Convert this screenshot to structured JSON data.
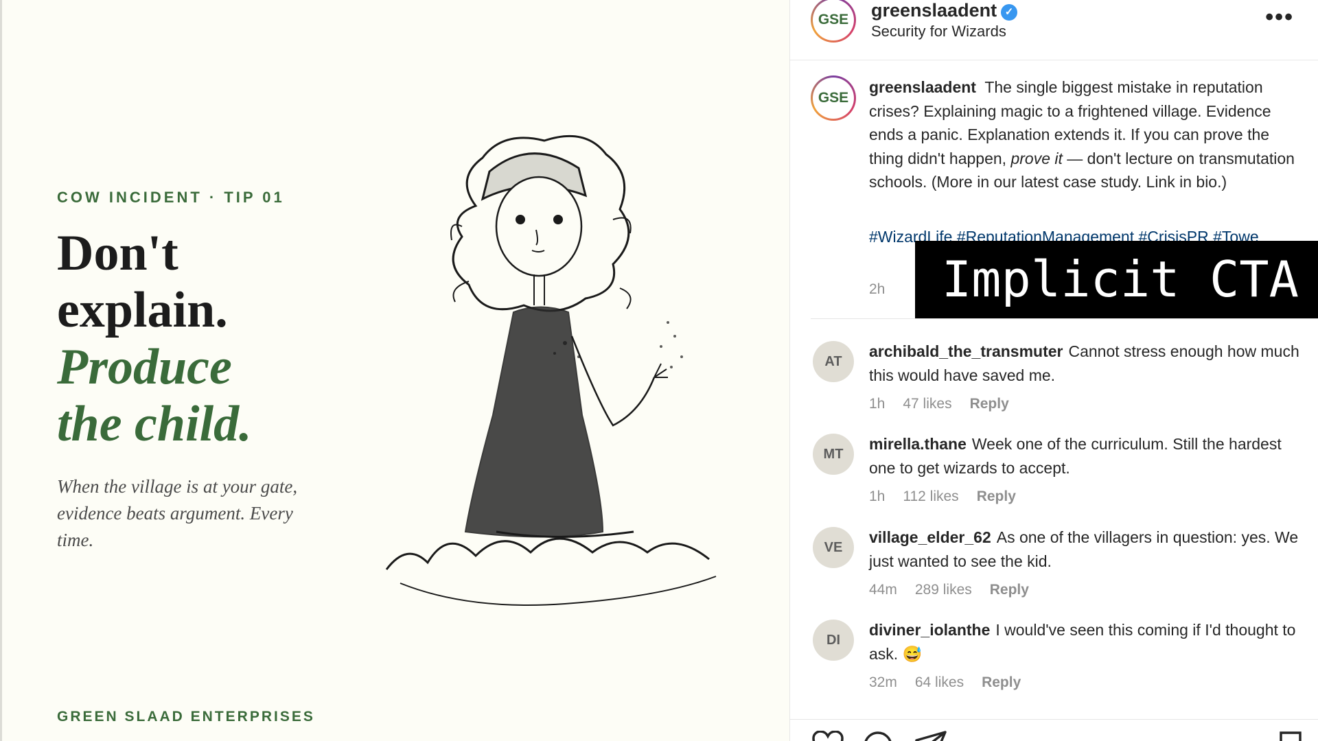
{
  "post": {
    "eyebrow": "COW INCIDENT · TIP 01",
    "headline_line1": "Don't",
    "headline_line2": "explain.",
    "headline_line3": "Produce",
    "headline_line4": "the child.",
    "subhead": "When the village is at your gate, evidence beats argument. Every time.",
    "brand": "GREEN SLAAD ENTERPRISES"
  },
  "header": {
    "avatar_text": "GSE",
    "username": "greenslaadent",
    "verified": "✓",
    "subtitle": "Security for Wizards",
    "more_icon": "more-icon"
  },
  "caption": {
    "avatar_text": "GSE",
    "username": "greenslaadent",
    "text_before": "The single biggest mistake in reputation crises? Explaining magic to a frightened village. Evidence ends a panic. Explanation extends it. If you can prove the thing didn't happen, ",
    "text_emph": "prove it",
    "text_after": " — don't lecture on transmutation schools. (More in our latest case study. Link in bio.)",
    "hashtags": "#WizardLife #ReputationManagement #CrisisPR #Towe",
    "time": "2h"
  },
  "overlay": {
    "label": "Implicit CTA"
  },
  "comments": [
    {
      "initials": "AT",
      "user": "archibald_the_transmuter",
      "text": "Cannot stress enough how much this would have saved me.",
      "time": "1h",
      "likes": "47 likes",
      "reply": "Reply"
    },
    {
      "initials": "MT",
      "user": "mirella.thane",
      "text": "Week one of the curriculum. Still the hardest one to get wizards to accept.",
      "time": "1h",
      "likes": "112 likes",
      "reply": "Reply"
    },
    {
      "initials": "VE",
      "user": "village_elder_62",
      "text": "As one of the villagers in question: yes. We just wanted to see the kid.",
      "time": "44m",
      "likes": "289 likes",
      "reply": "Reply"
    },
    {
      "initials": "DI",
      "user": "diviner_iolanthe",
      "text": "I would've seen this coming if I'd thought to ask. 😅",
      "time": "32m",
      "likes": "64 likes",
      "reply": "Reply"
    }
  ],
  "colors": {
    "brand_green": "#3a6b3a",
    "link_blue": "#00376b",
    "verified_blue": "#3897f0"
  }
}
